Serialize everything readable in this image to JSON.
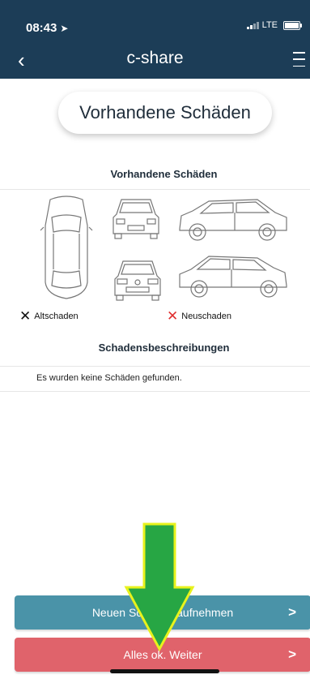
{
  "status_bar": {
    "time": "08:43",
    "network": "LTE"
  },
  "nav": {
    "title": "c-share"
  },
  "header_pill": {
    "label": "Vorhandene Schäden"
  },
  "damage_section": {
    "title": "Vorhandene Schäden"
  },
  "legend": {
    "old_damage": "Altschaden",
    "new_damage": "Neuschaden",
    "old_color": "#111111",
    "new_color": "#e03030"
  },
  "descriptions": {
    "title": "Schadensbeschreibungen",
    "empty_text": "Es wurden keine Schäden gefunden."
  },
  "buttons": {
    "add_damage": "Neuen Schaden aufnehmen",
    "continue": "Alles ok. Weiter"
  },
  "colors": {
    "nav_bg": "#1c3d57",
    "button_blue": "#4a93a8",
    "button_red": "#e0636b",
    "arrow_fill": "#27a644",
    "arrow_stroke": "#e8f21c"
  }
}
